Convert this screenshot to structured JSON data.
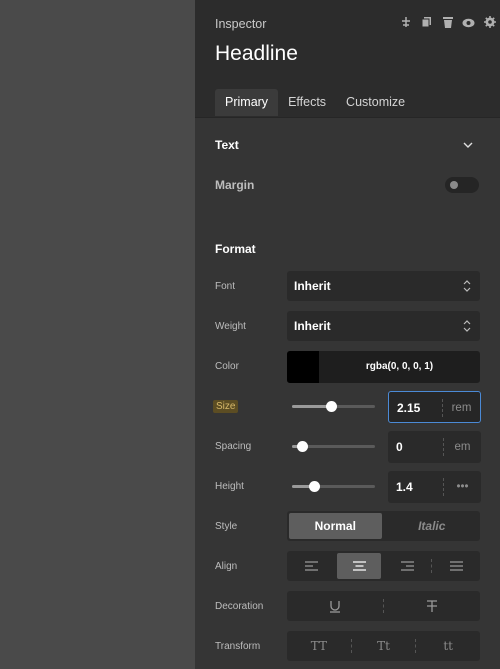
{
  "inspector": {
    "title": "Inspector",
    "element_name": "Headline",
    "header_icons": [
      "anchor-icon",
      "duplicate-icon",
      "delete-icon",
      "visibility-icon",
      "settings-icon"
    ]
  },
  "tabs": [
    {
      "label": "Primary",
      "active": true
    },
    {
      "label": "Effects",
      "active": false
    },
    {
      "label": "Customize",
      "active": false
    }
  ],
  "text_section": {
    "label": "Text",
    "expanded": true
  },
  "margin": {
    "label": "Margin",
    "enabled": false
  },
  "format": {
    "label": "Format",
    "font": {
      "label": "Font",
      "value": "Inherit"
    },
    "weight": {
      "label": "Weight",
      "value": "Inherit"
    },
    "color": {
      "label": "Color",
      "value": "rgba(0, 0, 0, 1)",
      "swatch": "#000000"
    },
    "size": {
      "label": "Size",
      "value": "2.15",
      "unit": "rem",
      "slider_fraction": 0.47
    },
    "spacing": {
      "label": "Spacing",
      "value": "0",
      "unit": "em",
      "slider_fraction": 0.12
    },
    "height": {
      "label": "Height",
      "value": "1.4",
      "unit": "•••",
      "slider_fraction": 0.27
    },
    "style": {
      "label": "Style",
      "options": [
        "Normal",
        "Italic"
      ],
      "selected": "Normal"
    },
    "align": {
      "label": "Align",
      "options": [
        "align-left-icon",
        "align-center-icon",
        "align-right-icon",
        "align-justify-icon"
      ],
      "selected": "align-center-icon"
    },
    "decoration": {
      "label": "Decoration",
      "options": [
        "underline-icon",
        "strikethrough-icon"
      ]
    },
    "transform": {
      "label": "Transform",
      "options": [
        "TT",
        "Tt",
        "tt"
      ]
    }
  },
  "colors": {
    "accent": "#4b8ad6",
    "panel": "#353535",
    "header": "#2c2c2c",
    "field": "#2a2a2a"
  }
}
